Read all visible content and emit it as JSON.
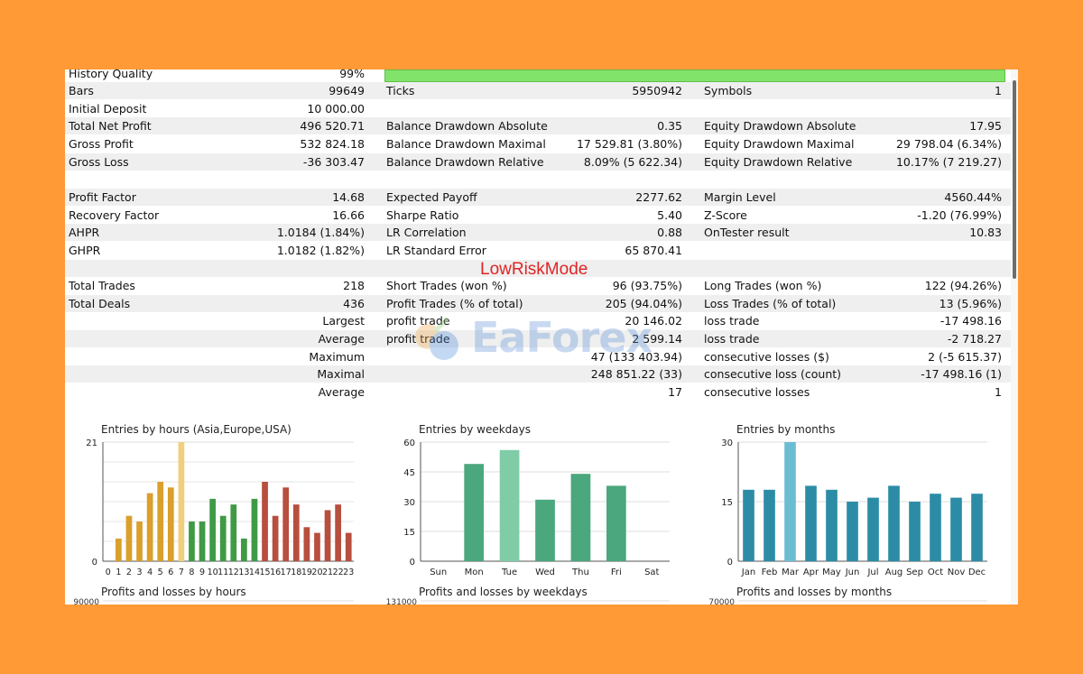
{
  "colors": {
    "background": "#FF9A36",
    "quality_bar": "#82E36A",
    "mode_label": "#E02424"
  },
  "quality": {
    "label": "History Quality",
    "value": "99%"
  },
  "summary_rows": [
    {
      "l1": "Bars",
      "v1": "99649",
      "l2": "Ticks",
      "v2": "5950942",
      "l3": "Symbols",
      "v3": "1"
    },
    {
      "l1": "Initial Deposit",
      "v1": "10 000.00",
      "l2": "",
      "v2": "",
      "l3": "",
      "v3": ""
    },
    {
      "l1": "Total Net Profit",
      "v1": "496 520.71",
      "l2": "Balance Drawdown Absolute",
      "v2": "0.35",
      "l3": "Equity Drawdown Absolute",
      "v3": "17.95"
    },
    {
      "l1": "Gross Profit",
      "v1": "532 824.18",
      "l2": "Balance Drawdown Maximal",
      "v2": "17 529.81 (3.80%)",
      "l3": "Equity Drawdown Maximal",
      "v3": "29 798.04 (6.34%)"
    },
    {
      "l1": "Gross Loss",
      "v1": "-36 303.47",
      "l2": "Balance Drawdown Relative",
      "v2": "8.09% (5 622.34)",
      "l3": "Equity Drawdown Relative",
      "v3": "10.17% (7 219.27)"
    },
    {
      "l1": "",
      "v1": "",
      "l2": "",
      "v2": "",
      "l3": "",
      "v3": ""
    },
    {
      "l1": "Profit Factor",
      "v1": "14.68",
      "l2": "Expected Payoff",
      "v2": "2277.62",
      "l3": "Margin Level",
      "v3": "4560.44%"
    },
    {
      "l1": "Recovery Factor",
      "v1": "16.66",
      "l2": "Sharpe Ratio",
      "v2": "5.40",
      "l3": "Z-Score",
      "v3": "-1.20 (76.99%)"
    },
    {
      "l1": "AHPR",
      "v1": "1.0184 (1.84%)",
      "l2": "LR Correlation",
      "v2": "0.88",
      "l3": "OnTester result",
      "v3": "10.83"
    },
    {
      "l1": "GHPR",
      "v1": "1.0182 (1.82%)",
      "l2": "LR Standard Error",
      "v2": "65 870.41",
      "l3": "",
      "v3": ""
    },
    {
      "l1": "",
      "v1": "",
      "l2": "",
      "v2": "",
      "l3": "",
      "v3": ""
    },
    {
      "l1": "Total Trades",
      "v1": "218",
      "l2": "Short Trades (won %)",
      "v2": "96 (93.75%)",
      "l3": "Long Trades (won %)",
      "v3": "122 (94.26%)"
    },
    {
      "l1": "Total Deals",
      "v1": "436",
      "l2": "Profit Trades (% of total)",
      "v2": "205 (94.04%)",
      "l3": "Loss Trades (% of total)",
      "v3": "13 (5.96%)"
    },
    {
      "l1": "",
      "v1": "Largest",
      "l2": "profit trade",
      "v2": "20 146.02",
      "l3": "loss trade",
      "v3": "-17 498.16"
    },
    {
      "l1": "",
      "v1": "Average",
      "l2": "profit trade",
      "v2": "2 599.14",
      "l3": "loss trade",
      "v3": "-2 718.27"
    },
    {
      "l1": "",
      "v1": "Maximum",
      "l2": "",
      "v2": "47 (133 403.94)",
      "l3": "consecutive losses ($)",
      "v3": "2 (-5 615.37)"
    },
    {
      "l1": "",
      "v1": "Maximal",
      "l2": "",
      "v2": "248 851.22 (33)",
      "l3": "consecutive loss (count)",
      "v3": "-17 498.16 (1)"
    },
    {
      "l1": "",
      "v1": "Average",
      "l2": "",
      "v2": "17",
      "l3": "consecutive losses",
      "v3": "1"
    }
  ],
  "mode_label": "LowRiskMode",
  "watermark": {
    "text": "EaForex"
  },
  "chart_data": [
    {
      "type": "bar",
      "title": "Entries by hours (Asia,Europe,USA)",
      "categories": [
        "0",
        "1",
        "2",
        "3",
        "4",
        "5",
        "6",
        "7",
        "8",
        "9",
        "10",
        "11",
        "12",
        "13",
        "14",
        "15",
        "16",
        "17",
        "18",
        "19",
        "20",
        "21",
        "22",
        "23"
      ],
      "values": [
        0,
        4,
        8,
        7,
        12,
        14,
        13,
        21,
        7,
        7,
        11,
        8,
        10,
        4,
        11,
        14,
        8,
        13,
        10,
        6,
        5,
        9,
        10,
        5
      ],
      "colors": [
        "#D9A02C",
        "#D9A02C",
        "#D9A02C",
        "#D9A02C",
        "#D9A02C",
        "#D9A02C",
        "#D9A02C",
        "#F1CF7E",
        "#3F9A45",
        "#3F9A45",
        "#3F9A45",
        "#3F9A45",
        "#3F9A45",
        "#3F9A45",
        "#3F9A45",
        "#B84E3E",
        "#B84E3E",
        "#B84E3E",
        "#B84E3E",
        "#B84E3E",
        "#B84E3E",
        "#B84E3E",
        "#B84E3E",
        "#B84E3E"
      ],
      "ylim": [
        0,
        21
      ],
      "yticks": [
        "21",
        "0"
      ],
      "grid": true,
      "bottom_title": "Profits and losses by hours",
      "bottom_axis_top": "90000"
    },
    {
      "type": "bar",
      "title": "Entries by weekdays",
      "categories": [
        "Sun",
        "Mon",
        "Tue",
        "Wed",
        "Thu",
        "Fri",
        "Sat"
      ],
      "values": [
        0,
        49,
        56,
        31,
        44,
        38,
        0
      ],
      "colors": [
        "#4BA77D",
        "#4BA77D",
        "#7FCCA6",
        "#4BA77D",
        "#4BA77D",
        "#4BA77D",
        "#4BA77D"
      ],
      "ylim": [
        0,
        60
      ],
      "yticks": [
        "60",
        "45",
        "30",
        "15",
        "0"
      ],
      "grid": true,
      "bottom_title": "Profits and losses by weekdays",
      "bottom_axis_top": "131000"
    },
    {
      "type": "bar",
      "title": "Entries by months",
      "categories": [
        "Jan",
        "Feb",
        "Mar",
        "Apr",
        "May",
        "Jun",
        "Jul",
        "Aug",
        "Sep",
        "Oct",
        "Nov",
        "Dec"
      ],
      "values": [
        18,
        18,
        30,
        19,
        18,
        15,
        16,
        19,
        15,
        17,
        16,
        17
      ],
      "colors": [
        "#2C8CA6",
        "#2C8CA6",
        "#6CBCD2",
        "#2C8CA6",
        "#2C8CA6",
        "#2C8CA6",
        "#2C8CA6",
        "#2C8CA6",
        "#2C8CA6",
        "#2C8CA6",
        "#2C8CA6",
        "#2C8CA6"
      ],
      "ylim": [
        0,
        30
      ],
      "yticks": [
        "30",
        "15",
        "0"
      ],
      "grid": true,
      "bottom_title": "Profits and losses by months",
      "bottom_axis_top": "70000"
    }
  ]
}
